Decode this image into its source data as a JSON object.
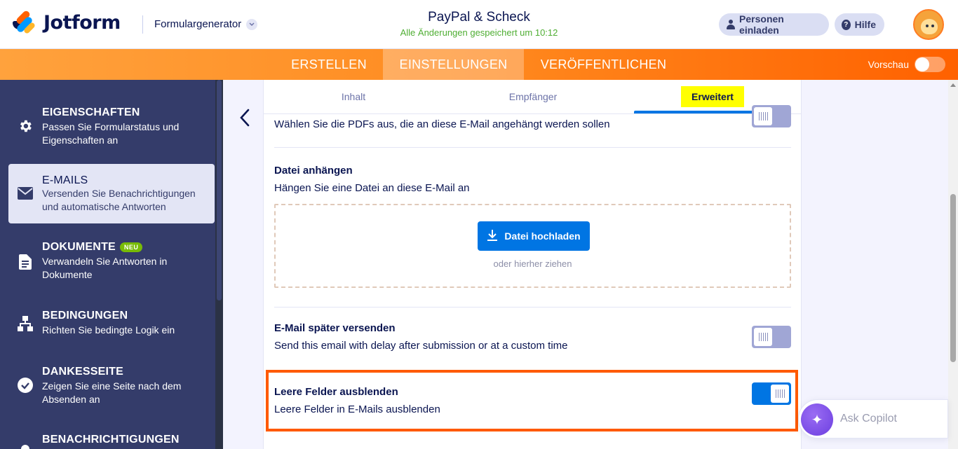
{
  "header": {
    "logo_text": "Jotform",
    "form_generator": "Formulargenerator",
    "form_title": "PayPal & Scheck",
    "saved_status": "Alle Änderungen gespeichert um 10:12",
    "invite_label": "Personen einladen",
    "help_label": "Hilfe"
  },
  "nav": {
    "tabs": [
      "ERSTELLEN",
      "EINSTELLUNGEN",
      "VERÖFFENTLICHEN"
    ],
    "active_tab": "EINSTELLUNGEN",
    "preview_label": "Vorschau",
    "preview_on": false
  },
  "sidebar": {
    "items": [
      {
        "title": "EIGENSCHAFTEN",
        "desc": "Passen Sie Formularstatus und Eigenschaften an",
        "icon": "gear-icon"
      },
      {
        "title": "E-MAILS",
        "desc": "Versenden Sie Benachrichtigungen und automatische Antworten",
        "icon": "envelope-icon",
        "active": true
      },
      {
        "title": "DOKUMENTE",
        "badge": "NEU",
        "desc": "Verwandeln Sie Antworten in Dokumente",
        "icon": "document-icon"
      },
      {
        "title": "BEDINGUNGEN",
        "desc": "Richten Sie bedingte Logik ein",
        "icon": "hierarchy-icon"
      },
      {
        "title": "DANKESSEITE",
        "desc": "Zeigen Sie eine Seite nach dem Absenden an",
        "icon": "check-circle-icon"
      },
      {
        "title": "BENACHRICHTIGUNGEN",
        "desc": "",
        "icon": "bell-icon"
      }
    ]
  },
  "subtabs": {
    "items": [
      "Inhalt",
      "Empfänger",
      "Erweitert"
    ],
    "active": "Erweitert"
  },
  "settings": {
    "pdf_desc": "Wählen Sie die PDFs aus, die an diese E-Mail angehängt werden sollen",
    "pdf_toggle_on": false,
    "attach_title": "Datei anhängen",
    "attach_desc": "Hängen Sie eine Datei an diese E-Mail an",
    "upload_label": "Datei hochladen",
    "drop_hint": "oder hierher ziehen",
    "later_title": "E-Mail später versenden",
    "later_desc": "Send this email with delay after submission or at a custom time",
    "later_toggle_on": false,
    "hide_title": "Leere Felder ausblenden",
    "hide_desc": "Leere Felder in E-Mails ausblenden",
    "hide_toggle_on": true
  },
  "copilot": {
    "label": "Ask Copilot"
  },
  "colors": {
    "brand_orange": "#ff6100",
    "sidebar_bg": "#343c6a",
    "primary_blue": "#0075e3",
    "saved_green": "#4fae33",
    "highlight_yellow": "#ffff00",
    "highlight_border": "#ff5a00"
  }
}
